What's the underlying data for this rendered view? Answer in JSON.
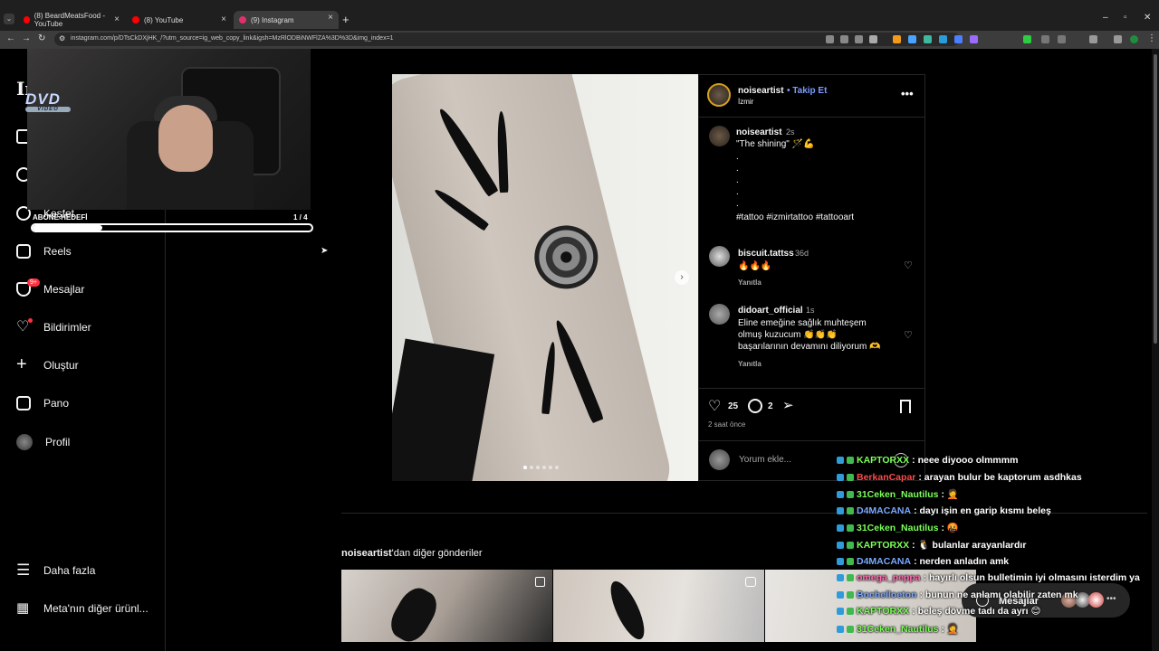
{
  "browser": {
    "tabs": [
      {
        "label": "(8) BeardMeatsFood - YouTube",
        "favicon_color": "#ff0000"
      },
      {
        "label": "(8) YouTube",
        "favicon_color": "#ff0000"
      },
      {
        "label": "(9) Instagram",
        "favicon_color": "#e1306c"
      }
    ],
    "url": "instagram.com/p/DTsCkDXjHK_/?utm_source=ig_web_copy_link&igsh=MzRlODBiNWFlZA%3D%3D&img_index=1",
    "icons": [
      "back-icon",
      "forward-icon",
      "reload-icon",
      "site-info-icon",
      "new-tab-icon",
      "minimize-icon",
      "maximize-icon",
      "close-icon",
      "extensions-icon",
      "profile-icon",
      "menu-icon"
    ]
  },
  "sidebar": {
    "logo": "In",
    "items": [
      {
        "label": "Keşfet",
        "icon": "compass-icon"
      },
      {
        "label": "Reels",
        "icon": "reels-icon"
      },
      {
        "label": "Mesajlar",
        "icon": "messenger-icon",
        "badge": "9+"
      },
      {
        "label": "Bildirimler",
        "icon": "heart-icon"
      },
      {
        "label": "Oluştur",
        "icon": "plus-icon"
      },
      {
        "label": "Pano",
        "icon": "dashboard-icon"
      },
      {
        "label": "Profil",
        "icon": "profile-avatar-icon"
      }
    ],
    "bottom": [
      {
        "label": "Daha fazla",
        "icon": "hamburger-icon"
      },
      {
        "label": "Meta'nın diğer ürünl...",
        "icon": "apps-icon"
      }
    ]
  },
  "overlay": {
    "dvd_text": "DVD",
    "dvd_sub": "VIDEO",
    "goal_label": "ABONE HEDEFİ",
    "goal_count": "1 / 4",
    "goal_progress": 0.25
  },
  "post": {
    "author": "noiseartist",
    "follow_label": "• Takip Et",
    "location": "İzmir",
    "caption_time": "2s",
    "caption": "\"The shining\" 🪄💪",
    "caption_dots": [
      ".",
      ".",
      ".",
      ".",
      "."
    ],
    "hashtags": "#tattoo #izmirtattoo #tattooart",
    "comments": [
      {
        "user": "biscuit.tattss",
        "time": "36d",
        "text": "🔥🔥🔥",
        "reply": "Yanıtla"
      },
      {
        "user": "didoart_official",
        "time": "1s",
        "text_lines": [
          "Eline emeğine sağlık muhteşem",
          "olmuş kuzucum 👏👏👏",
          "başarılarının devamını diliyorum 🫶"
        ],
        "reply": "Yanıtla"
      }
    ],
    "likes": "25",
    "comment_count": "2",
    "time_ago": "2 saat önce",
    "comment_placeholder": "Yorum ekle...",
    "image_count": 6
  },
  "more_posts": {
    "title_user": "noiseartist",
    "title_rest": "'dan diğer gönderiler"
  },
  "messages_pill": {
    "label": "Mesajlar"
  },
  "chat": [
    {
      "user": "KAPTORXX",
      "color": "#7bff5a",
      "text": ": neee diyooo olmmmm"
    },
    {
      "user": "BerkanCapar",
      "color": "#ff4a4a",
      "text": ": arayan bulur be kaptorum asdhkas"
    },
    {
      "user": "31Ceken_Nautilus",
      "color": "#7bff5a",
      "text": ": 🤦"
    },
    {
      "user": "D4MACANA",
      "color": "#7aa8ff",
      "text": ": dayı işin en garip kısmı beleş"
    },
    {
      "user": "31Ceken_Nautilus",
      "color": "#7bff5a",
      "text": ": 🤬"
    },
    {
      "user": "KAPTORXX",
      "color": "#7bff5a",
      "text": ": 🐧 bulanlar arayanlardır"
    },
    {
      "user": "D4MACANA",
      "color": "#7aa8ff",
      "text": ": nerden anladın amk"
    },
    {
      "user": "omega_peppa",
      "color": "#ff6fb0",
      "text": ": hayırlı olsun bulletimin iyi olmasını isterdim ya"
    },
    {
      "user": "Bochelloeton",
      "color": "#7aa8ff",
      "text": ": bunun ne anlamı olabilir zaten mk"
    },
    {
      "user": "KAPTORXX",
      "color": "#7bff5a",
      "text": ": beleş dövme tadı da ayrı 😊"
    },
    {
      "user": "31Ceken_Nautilus",
      "color": "#7bff5a",
      "text": ": 🤦"
    }
  ],
  "colors": {
    "background": "#000000",
    "accent": "#0095f6",
    "notification": "#ff3040"
  }
}
